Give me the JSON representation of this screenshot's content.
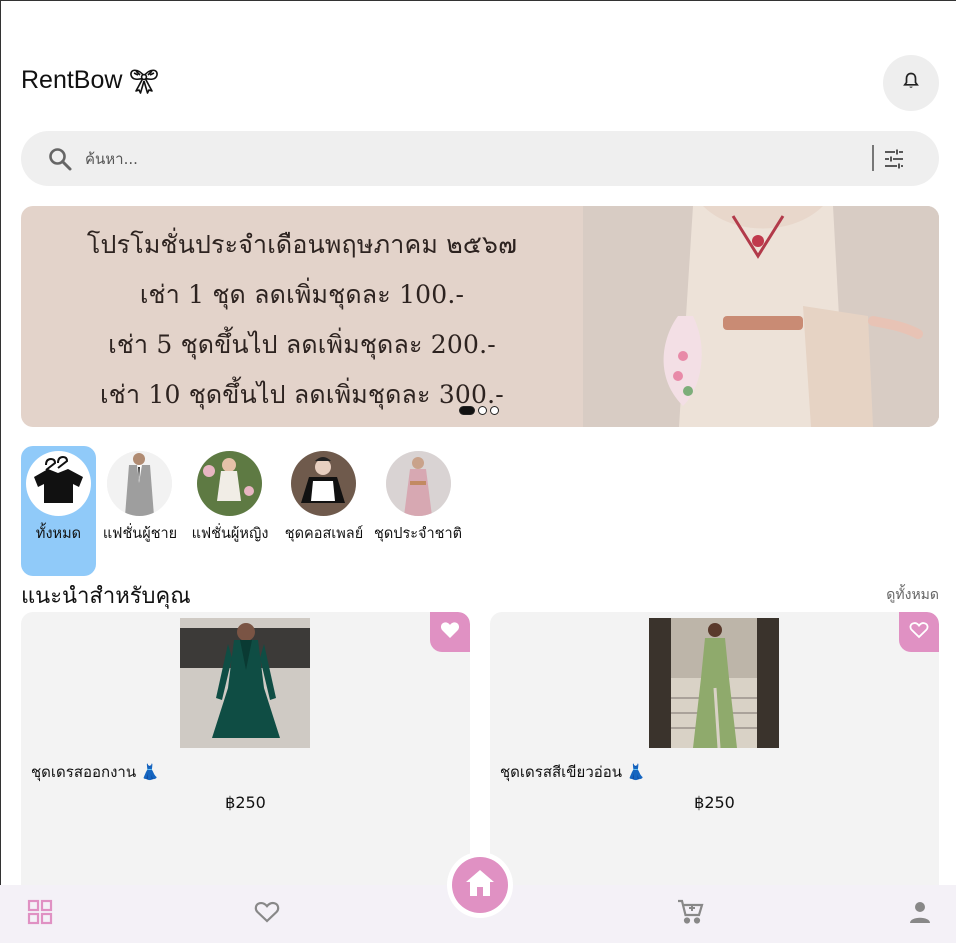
{
  "app": {
    "brand": "RentBow",
    "brand_icon": "ribbon-bow-icon",
    "notification_icon": "bell-icon"
  },
  "search": {
    "placeholder": "ค้นหา...",
    "value": "",
    "icons": [
      "search-icon",
      "filter-sliders-icon"
    ]
  },
  "banner": {
    "lines": [
      "โปรโมชั่นประจำเดือนพฤษภาคม ๒๕๖๗",
      "เช่า 1 ชุด ลดเพิ่มชุดละ 100.-",
      "เช่า 5 ชุดขึ้นไป ลดเพิ่มชุดละ 200.-",
      "เช่า 10 ชุดขึ้นไป ลดเพิ่มชุดละ 300.-"
    ],
    "slide_count": 3,
    "active_slide": 1
  },
  "categories": [
    {
      "label": "ทั้งหมด",
      "active": true
    },
    {
      "label": "แฟชั่นผู้ชาย",
      "active": false
    },
    {
      "label": "แฟชั่นผู้หญิง",
      "active": false
    },
    {
      "label": "ชุดคอสเพลย์",
      "active": false
    },
    {
      "label": "ชุดประจำชาติ",
      "active": false
    }
  ],
  "recommended": {
    "title": "แนะนำสำหรับคุณ",
    "see_all": "ดูทั้งหมด",
    "items": [
      {
        "name": "ชุดเดรสออกงาน 👗",
        "price": "฿250",
        "favorite": true
      },
      {
        "name": "ชุดเดรสสีเขียวอ่อน 👗",
        "price": "฿250",
        "favorite": false
      }
    ]
  },
  "bottom_nav": {
    "items": [
      "grid-icon",
      "heart-icon",
      "home-icon",
      "cart-icon",
      "profile-icon"
    ],
    "active": "home-icon"
  },
  "colors": {
    "accent_pink": "#e091c3",
    "category_active": "#90caf9",
    "nav_bg": "#f4f1f7"
  }
}
